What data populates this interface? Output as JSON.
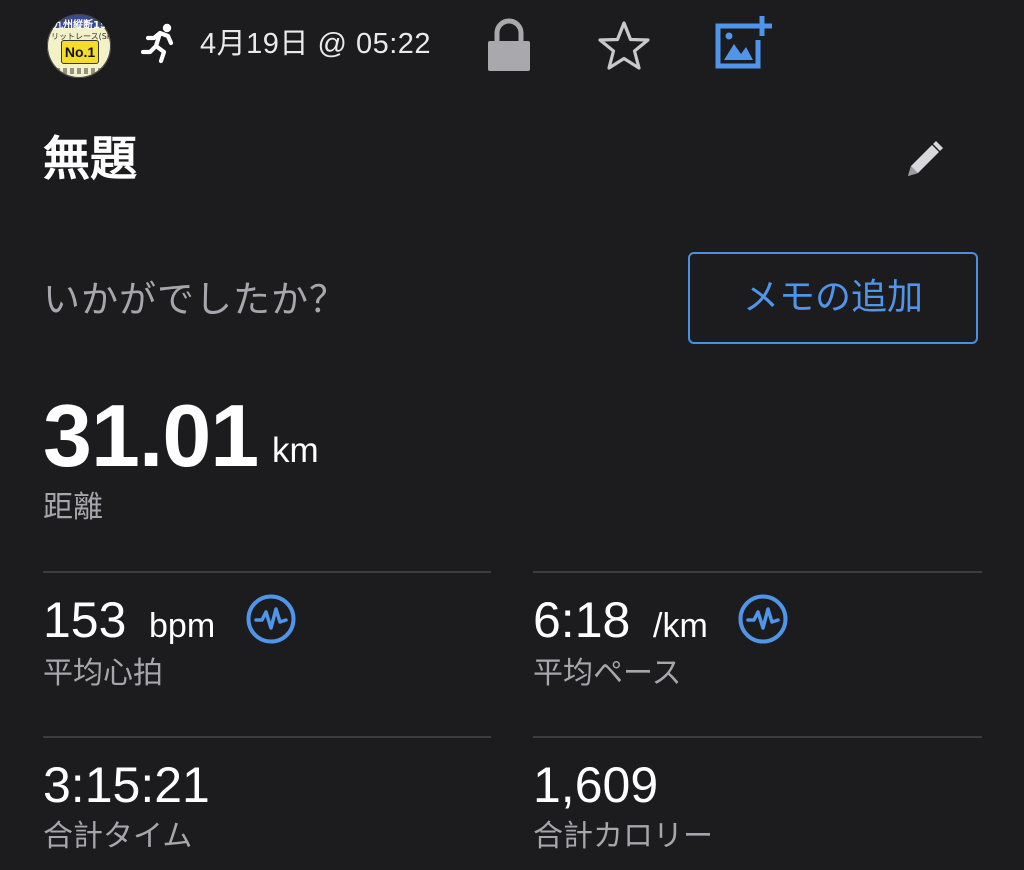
{
  "header": {
    "avatar": {
      "top_text": "九州縦断159",
      "line_text": "リットレース(SPECIAL)",
      "badge": "No.1"
    },
    "activity_icon": "running-person-icon",
    "datetime": "4月19日 @ 05:22",
    "icons": [
      "lock-icon",
      "star-icon",
      "add-photo-icon"
    ]
  },
  "activity": {
    "title": "無題",
    "edit_icon": "pencil-icon",
    "feeling_prompt": "いかがでしたか？",
    "memo_button": "メモの追加"
  },
  "distance": {
    "value": "31.01",
    "unit": "km",
    "label": "距離"
  },
  "stats": {
    "avg_hr": {
      "value": "153",
      "unit": "bpm",
      "label": "平均心拍",
      "icon": "heart-rate-wave-icon"
    },
    "avg_pace": {
      "value": "6:18",
      "unit": "/km",
      "label": "平均ペース",
      "icon": "heart-rate-wave-icon"
    },
    "total_time": {
      "value": "3:15:21",
      "label": "合計タイム"
    },
    "total_calories": {
      "value": "1,609",
      "label": "合計カロリー"
    }
  },
  "colors": {
    "background": "#1c1c1e",
    "accent": "#4f95ea",
    "secondary_text": "#a6a6ac",
    "divider": "#3b3b40"
  }
}
